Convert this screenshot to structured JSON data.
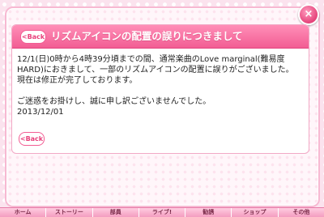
{
  "dialog": {
    "close_label": "×",
    "back_label": "<Back",
    "title": "リズムアイコンの配置の誤りにつきまして",
    "paragraphs": [
      "12/1(日)0時から4時39分頃までの間、通常楽曲のLove marginal(難易度HARD)におきまして、一部のリズムアイコンの配置に誤りがございました。",
      "現在は修正が完了しております。",
      "",
      "ご迷惑をお掛けし、誠に申し訳ございませんでした。",
      "2013/12/01"
    ],
    "bottom_back_label": "<Back"
  },
  "tabbar": {
    "tabs": [
      "ホーム",
      "ストーリー",
      "部員",
      "ライブ!",
      "勧誘",
      "ショップ",
      "その他"
    ]
  },
  "colors": {
    "accent": "#f25d93",
    "panel_border": "#f7b9d2",
    "close_button": "#e5437a"
  },
  "icons": {
    "close": "close-icon"
  }
}
